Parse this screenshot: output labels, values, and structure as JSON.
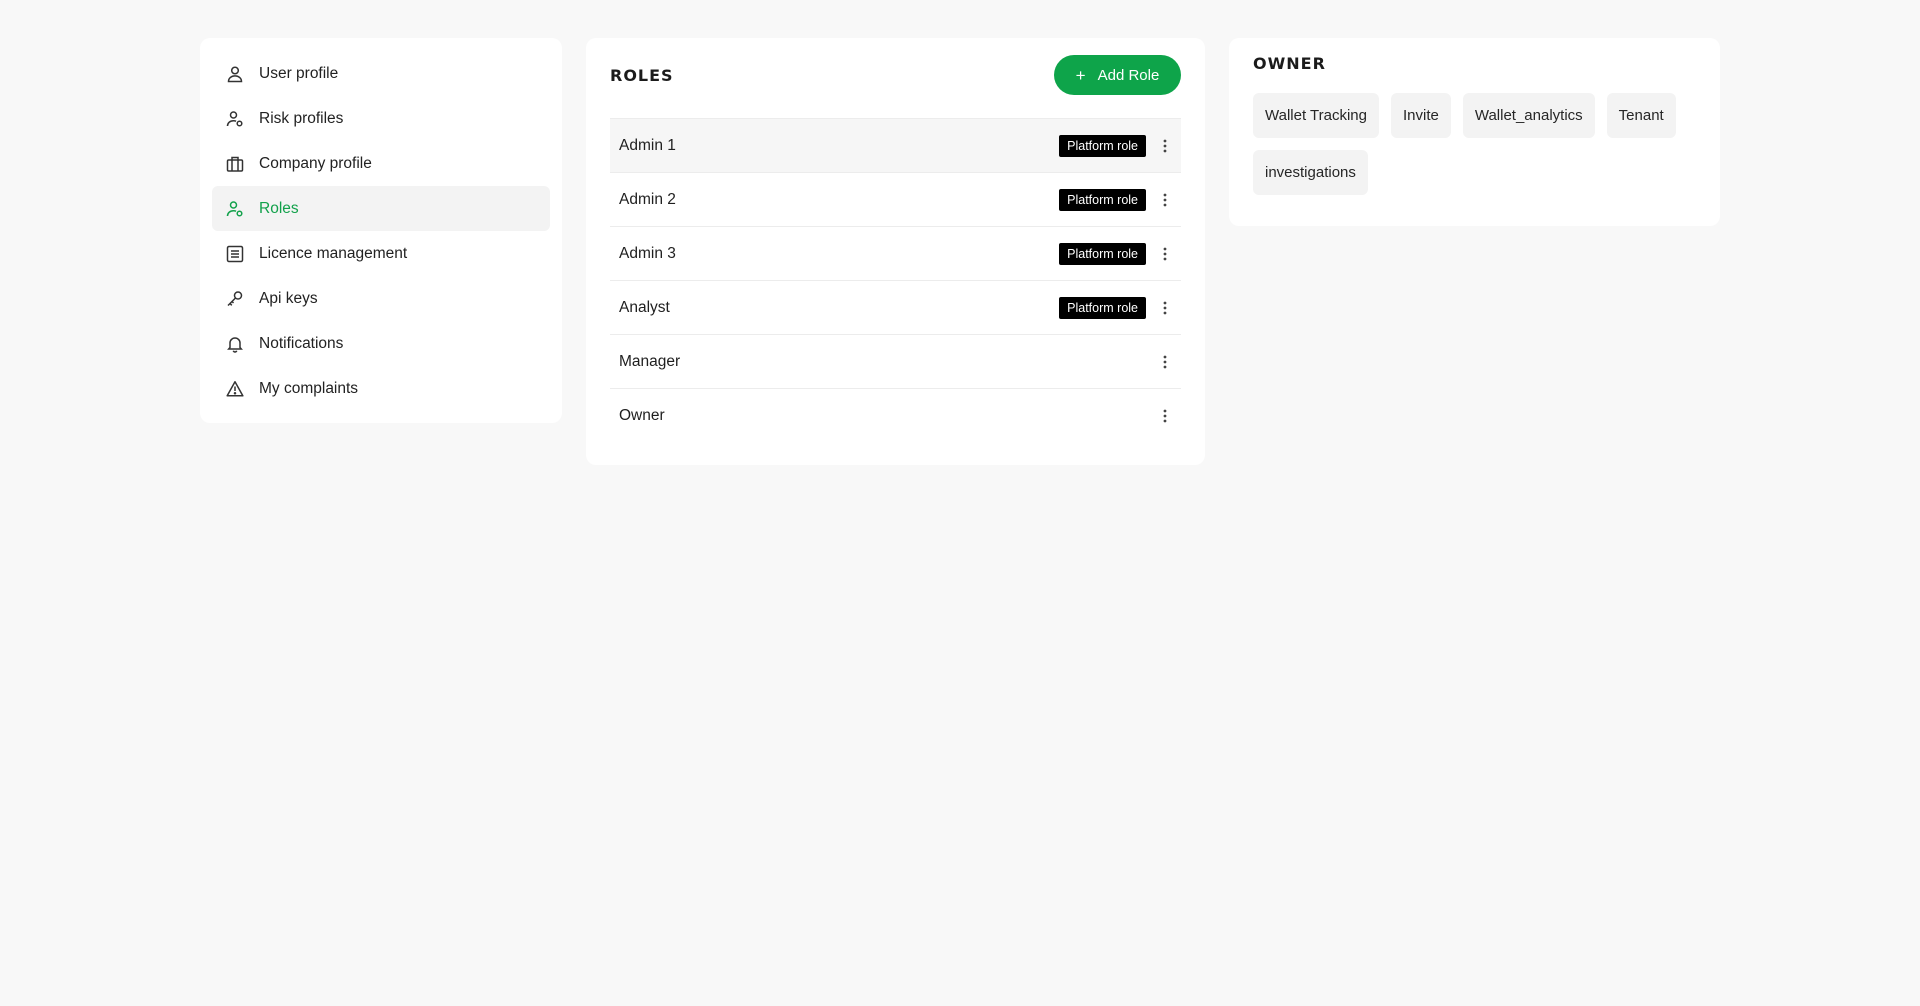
{
  "sidebar": {
    "items": [
      {
        "label": "User profile",
        "icon": "user-icon"
      },
      {
        "label": "Risk profiles",
        "icon": "user-settings-icon"
      },
      {
        "label": "Company profile",
        "icon": "briefcase-icon"
      },
      {
        "label": "Roles",
        "icon": "user-role-icon",
        "active": true
      },
      {
        "label": "Licence management",
        "icon": "document-list-icon"
      },
      {
        "label": "Api keys",
        "icon": "key-icon"
      },
      {
        "label": "Notifications",
        "icon": "bell-icon"
      },
      {
        "label": "My complaints",
        "icon": "warning-icon"
      }
    ]
  },
  "roles": {
    "title": "ROLES",
    "add_button": "Add Role",
    "badge_label": "Platform role",
    "rows": [
      {
        "name": "Admin 1",
        "badge": "Platform role"
      },
      {
        "name": "Admin 2",
        "badge": "Platform role"
      },
      {
        "name": "Admin 3",
        "badge": "Platform role"
      },
      {
        "name": "Analyst",
        "badge": "Platform role"
      },
      {
        "name": "Manager",
        "badge": ""
      },
      {
        "name": "Owner",
        "badge": ""
      }
    ]
  },
  "owner": {
    "title": "OWNER",
    "permissions": [
      "Wallet Tracking",
      "Invite",
      "Wallet_analytics",
      "Tenant",
      "investigations"
    ]
  },
  "colors": {
    "accent": "#0ea44a",
    "active_text": "#12a14b",
    "badge_bg": "#000000",
    "page_bg": "#f8f8f8"
  }
}
